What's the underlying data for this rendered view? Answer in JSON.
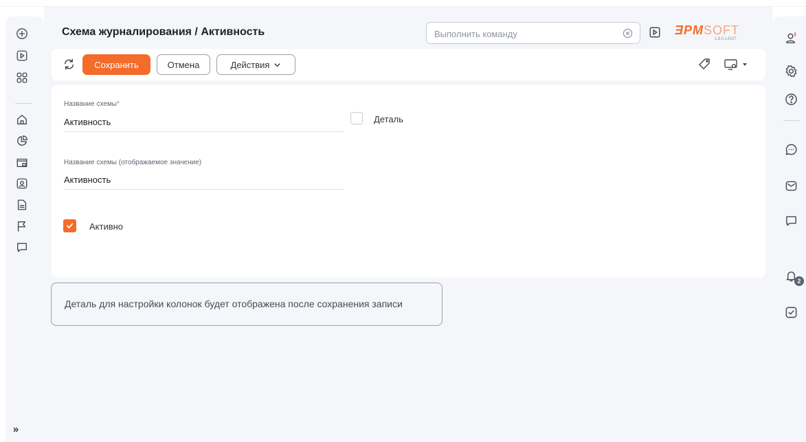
{
  "header": {
    "title": "Схема журналирования / Активность",
    "command_placeholder": "Выполнить команду",
    "logo_bpm": "ƎPM",
    "logo_soft": "SOFT",
    "version": "1.8.0.14107"
  },
  "toolbar": {
    "save_label": "Сохранить",
    "cancel_label": "Отмена",
    "actions_label": "Действия"
  },
  "form": {
    "schema_name_label": "Название схемы",
    "required_mark": "*",
    "schema_name_value": "Активность",
    "caption_label": "Название схемы (отображаемое значение)",
    "caption_value": "Активность",
    "detail_label": "Деталь",
    "detail_checked": false,
    "active_label": "Активно",
    "active_checked": true
  },
  "info": {
    "message": "Деталь для настройки колонок будет отображена после сохранения записи"
  },
  "left_sidebar": {
    "icons": [
      "add-icon",
      "play-icon",
      "apps-icon",
      "home-icon",
      "dashboard-icon",
      "folder-lock-icon",
      "contact-icon",
      "document-icon",
      "flag-icon",
      "chat-icon"
    ],
    "expand_label": "»"
  },
  "right_sidebar": {
    "icons": [
      "profile-icon",
      "gear-icon",
      "help-icon",
      "chat-icon",
      "mail-icon",
      "message-icon",
      "bell-icon",
      "task-icon"
    ],
    "notification_count": "2"
  },
  "colors": {
    "accent": "#f46b2a",
    "background": "#f4f6fa"
  }
}
